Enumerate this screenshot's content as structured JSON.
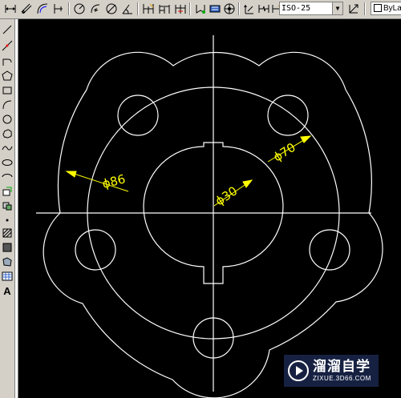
{
  "toolbar": {
    "buttons": [
      "dim-linear-icon",
      "dim-aligned-icon",
      "dim-arc-length-icon",
      "dim-ordinate-icon",
      "dim-radius-icon",
      "dim-jogged-icon",
      "dim-diameter-icon",
      "dim-angular-icon",
      "quick-dim-icon",
      "dim-baseline-icon",
      "dim-continue-icon",
      "dim-space-icon",
      "dim-break-icon",
      "tolerance-icon",
      "center-mark-icon",
      "dim-inspect-icon",
      "dim-jogged-linear-icon",
      "dim-edit-icon"
    ],
    "dimstyle": {
      "value": "ISO-25"
    },
    "layer": {
      "value": "ByLay"
    }
  },
  "left_toolbar": {
    "tools": [
      "line-icon",
      "construction-line-icon",
      "polyline-icon",
      "polygon-icon",
      "rectangle-icon",
      "arc-icon",
      "circle-icon",
      "revision-cloud-icon",
      "spline-icon",
      "ellipse-icon",
      "ellipse-arc-icon",
      "insert-block-icon",
      "make-block-icon",
      "point-icon",
      "hatch-icon",
      "gradient-icon",
      "region-icon",
      "table-icon",
      "multiline-text-icon"
    ],
    "text_tool_label": "A"
  },
  "drawing": {
    "dimensions": {
      "outer": "ϕ86",
      "bolt_circle": "ϕ70",
      "bore": "ϕ30"
    },
    "colors": {
      "background": "#000000",
      "geometry": "#ffffff",
      "dimension": "#ffff00"
    }
  },
  "watermark": {
    "title": "溜溜自学",
    "url": "ZIXUE.3D66.COM"
  }
}
